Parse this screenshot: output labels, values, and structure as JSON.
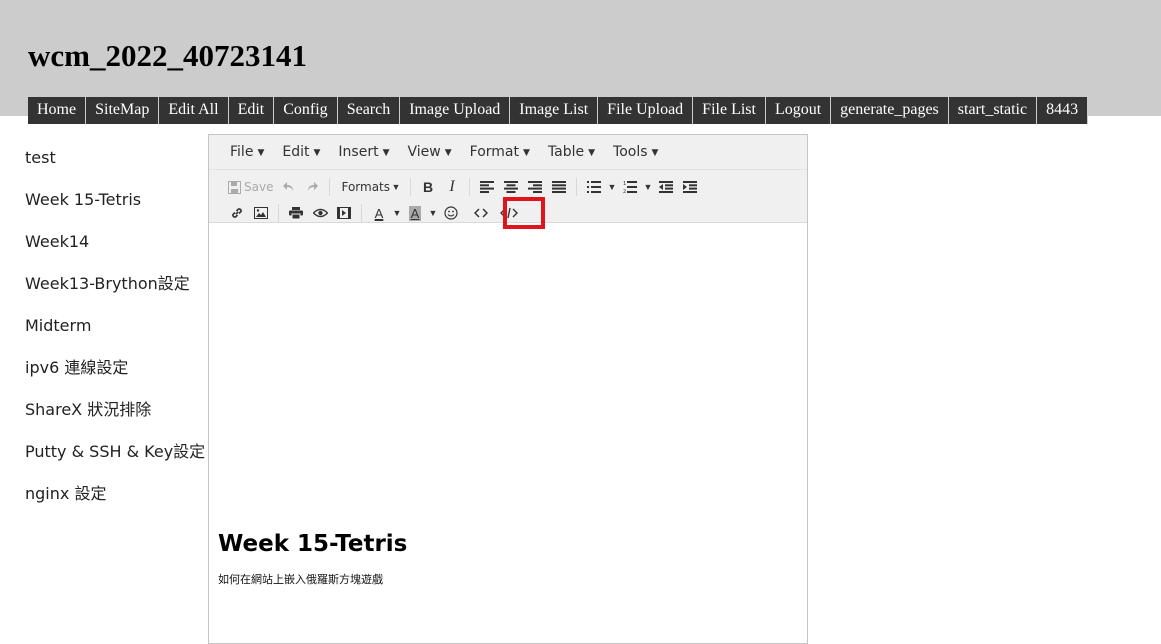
{
  "site_title": "wcm_2022_40723141",
  "nav": [
    "Home",
    "SiteMap",
    "Edit All",
    "Edit",
    "Config",
    "Search",
    "Image Upload",
    "Image List",
    "File Upload",
    "File List",
    "Logout",
    "generate_pages",
    "start_static",
    "8443"
  ],
  "sidebar": [
    "test",
    "Week 15-Tetris",
    "Week14",
    "Week13-Brython設定",
    "Midterm",
    "ipv6 連線設定",
    "ShareX 狀況排除",
    "Putty & SSH & Key設定",
    "nginx 設定"
  ],
  "editor": {
    "menus": [
      "File",
      "Edit",
      "Insert",
      "View",
      "Format",
      "Table",
      "Tools"
    ],
    "toolbar": {
      "save_label": "Save",
      "formats_label": "Formats",
      "bold_label": "B",
      "italic_label": "I",
      "text_color_label": "A",
      "bg_color_label": "A"
    },
    "content": {
      "heading": "Week 15-Tetris",
      "paragraph": "如何在網站上嵌入俄羅斯方塊遊戲"
    }
  },
  "colors": {
    "header_bg": "#cccccc",
    "nav_bg": "#333333",
    "highlight": "#e0141c"
  },
  "highlighted_tool": "code-sample-icon"
}
